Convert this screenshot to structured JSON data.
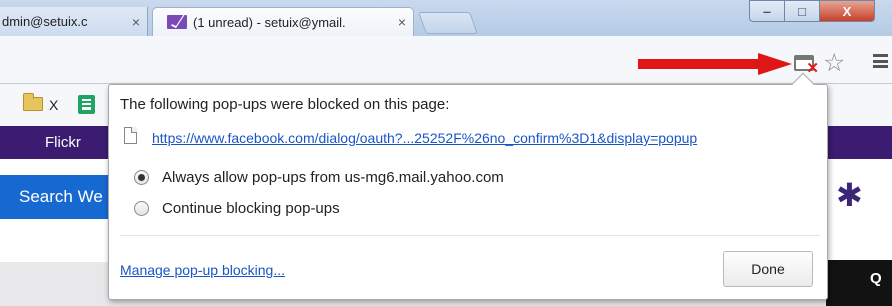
{
  "tabs": [
    {
      "title": "dmin@setuix.c",
      "close": "×"
    },
    {
      "title": "(1 unread) - setuix@ymail.",
      "close": "×"
    }
  ],
  "window_controls": {
    "minimize": "‒",
    "maximize": "□",
    "close": "X"
  },
  "bookmarks": {
    "item_x": "X"
  },
  "page": {
    "flickr_link": "Flickr",
    "search_button": "Search We"
  },
  "popup_bubble": {
    "title": "The following pop-ups were blocked on this page:",
    "blocked_url": "https://www.facebook.com/dialog/oauth?...25252F%26no_confirm%3D1&display=popup",
    "options": [
      {
        "label": "Always allow pop-ups from us-mg6.mail.yahoo.com",
        "selected": true
      },
      {
        "label": "Continue blocking pop-ups",
        "selected": false
      }
    ],
    "manage_link": "Manage pop-up blocking...",
    "done_button": "Done"
  },
  "colors": {
    "purple_bar": "#3b1c70",
    "search_blue": "#1769d2",
    "arrow_red": "#e01616",
    "link_blue": "#1a55c7"
  },
  "icons": [
    "mail-icon",
    "popup-blocked-icon",
    "star-icon",
    "menu-icon",
    "folder-icon",
    "sheets-icon",
    "gear-icon",
    "page-icon"
  ]
}
